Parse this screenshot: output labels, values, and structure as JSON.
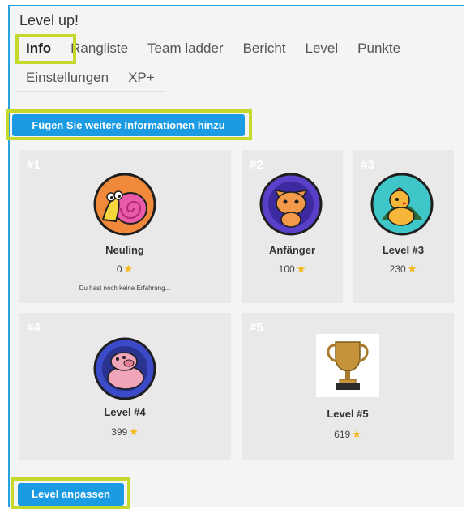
{
  "app_title": "Level up!",
  "tabs_row1": [
    {
      "label": "Info",
      "active": true
    },
    {
      "label": "Rangliste"
    },
    {
      "label": "Team ladder"
    },
    {
      "label": "Bericht"
    },
    {
      "label": "Level"
    },
    {
      "label": "Punkte"
    }
  ],
  "tabs_row2": [
    {
      "label": "Einstellungen"
    },
    {
      "label": "XP+"
    }
  ],
  "add_info_button": "Fügen Sie weitere Informationen hinzu",
  "levels": [
    {
      "num": "#1",
      "name": "Neuling",
      "points": "0",
      "description": "Du hast noch keine Erfahrung...",
      "avatar": "snail-icon"
    },
    {
      "num": "#2",
      "name": "Anfänger",
      "points": "100",
      "avatar": "cat-icon"
    },
    {
      "num": "#3",
      "name": "Level #3",
      "points": "230",
      "avatar": "chick-icon"
    },
    {
      "num": "#4",
      "name": "Level #4",
      "points": "399",
      "avatar": "pig-icon"
    },
    {
      "num": "#5",
      "name": "Level #5",
      "points": "619",
      "avatar": "trophy-icon"
    }
  ],
  "adjust_levels_button": "Level anpassen",
  "colors": {
    "accent": "#1a9be4",
    "highlight": "#c5d92d",
    "star": "#f3b817"
  }
}
